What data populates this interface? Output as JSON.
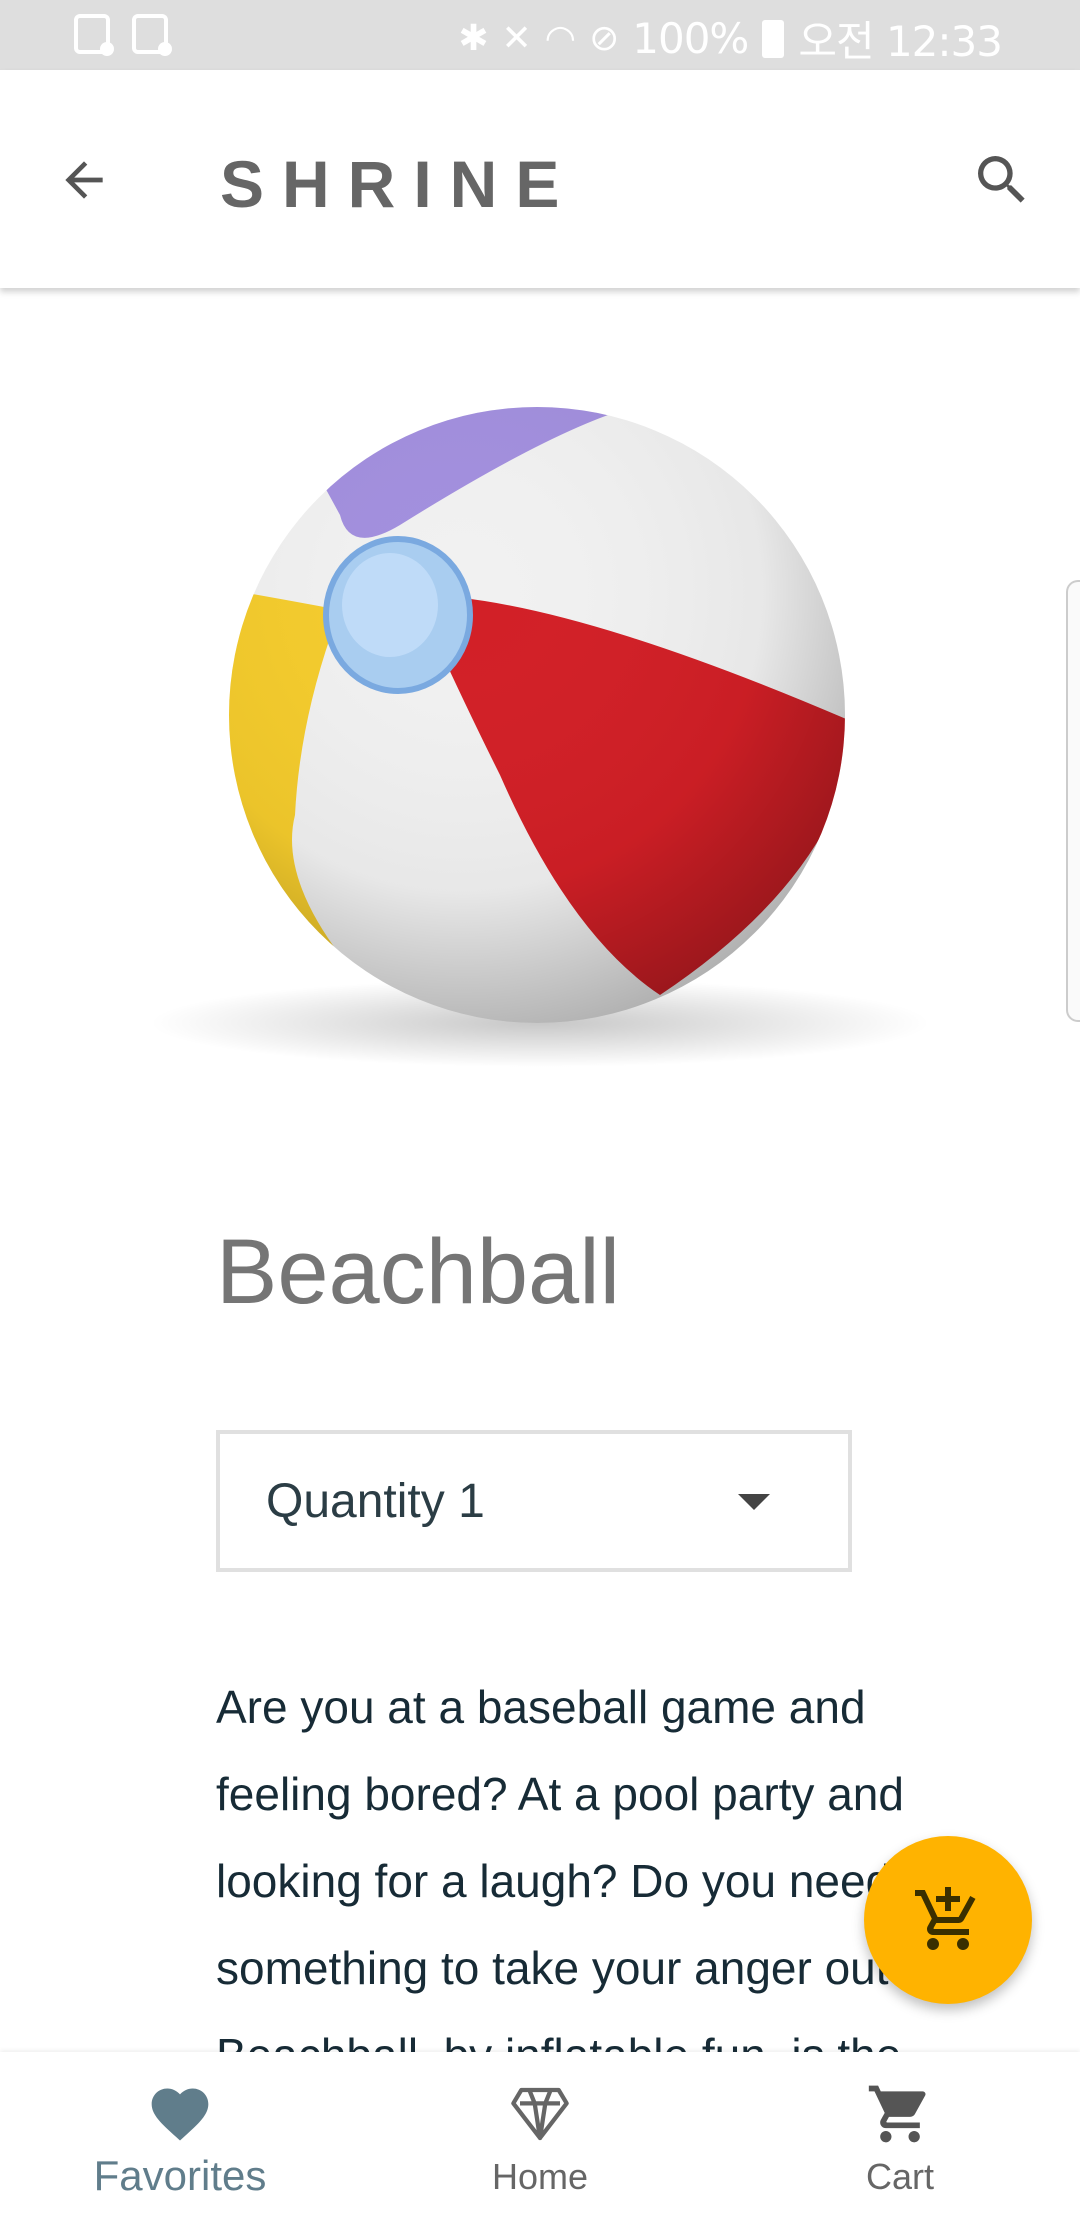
{
  "status_bar": {
    "battery": "100%",
    "time": "오전 12:33"
  },
  "app_bar": {
    "title": "SHRINE",
    "back_icon": "arrow-back-icon",
    "search_icon": "search-icon"
  },
  "product": {
    "image": "beachball-image",
    "title": "Beachball",
    "quantity_label": "Quantity 1",
    "description": "Are you at a baseball game and feeling bored? At a pool party and looking for a laugh? Do you need something to take your anger out? Beachball, by inflatable fun, is the"
  },
  "fab": {
    "icon": "add-shopping-cart-icon",
    "color": "#ffb300"
  },
  "bottom_nav": {
    "items": [
      {
        "label": "Favorites",
        "icon": "heart-icon",
        "active": true
      },
      {
        "label": "Home",
        "icon": "diamond-icon",
        "active": false
      },
      {
        "label": "Cart",
        "icon": "cart-icon",
        "active": false
      }
    ]
  },
  "colors": {
    "accent": "#ffb300",
    "active_nav": "#607d8b",
    "status_bar": "#dedede"
  }
}
